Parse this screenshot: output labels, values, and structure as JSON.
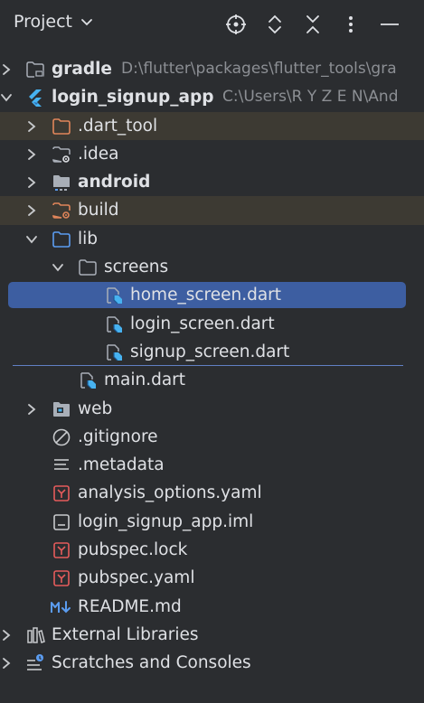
{
  "header": {
    "title": "Project",
    "icons": [
      "select-opened-file-icon",
      "expand-all-icon",
      "collapse-all-icon",
      "options-icon",
      "hide-icon"
    ]
  },
  "tree": {
    "gradle": {
      "label": "gradle",
      "path": "D:\\flutter\\packages\\flutter_tools\\gra"
    },
    "root": {
      "label": "login_signup_app",
      "path": "C:\\Users\\R Y Z E N\\And"
    },
    "dart_tool": {
      "label": ".dart_tool"
    },
    "idea": {
      "label": ".idea"
    },
    "android": {
      "label": "android"
    },
    "build": {
      "label": "build"
    },
    "lib": {
      "label": "lib"
    },
    "screens": {
      "label": "screens"
    },
    "home_screen": {
      "label": "home_screen.dart"
    },
    "login_screen": {
      "label": "login_screen.dart"
    },
    "signup_screen": {
      "label": "signup_screen.dart"
    },
    "main": {
      "label": "main.dart"
    },
    "web": {
      "label": "web"
    },
    "gitignore": {
      "label": ".gitignore"
    },
    "metadata": {
      "label": ".metadata"
    },
    "analysis_options": {
      "label": "analysis_options.yaml"
    },
    "iml": {
      "label": "login_signup_app.iml"
    },
    "pubspec_lock": {
      "label": "pubspec.lock"
    },
    "pubspec_yaml": {
      "label": "pubspec.yaml"
    },
    "readme": {
      "label": "README.md"
    },
    "external_libraries": {
      "label": "External Libraries"
    },
    "scratches": {
      "label": "Scratches and Consoles"
    }
  },
  "colors": {
    "background": "#2b2d30",
    "selection": "#3d5ea1",
    "excluded_highlight": "#3d3a33",
    "folder_outline": "#a9afb8",
    "excluded_folder": "#e0855a",
    "yaml_red": "#e55b5b",
    "readme_blue": "#5b9cf0",
    "flutter_blue": "#47b2f0"
  }
}
